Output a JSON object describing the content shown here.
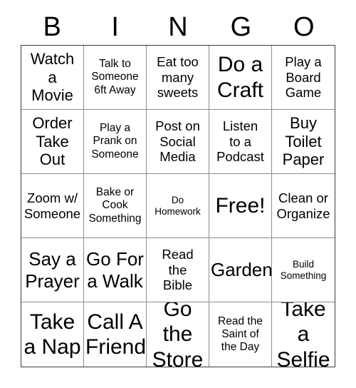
{
  "header": {
    "letters": [
      "B",
      "I",
      "N",
      "G",
      "O"
    ]
  },
  "grid": {
    "columns": 5,
    "rows": 5,
    "free_space_label": "Free!",
    "free_space_index": 12,
    "cells": [
      {
        "text": "Watch\na\nMovie",
        "size": "lg"
      },
      {
        "text": "Talk to\nSomeone\n6ft Away",
        "size": "sm"
      },
      {
        "text": "Eat too\nmany\nsweets",
        "size": "md"
      },
      {
        "text": "Do a\nCraft",
        "size": "xxl"
      },
      {
        "text": "Play a\nBoard\nGame",
        "size": "md"
      },
      {
        "text": "Order\nTake\nOut",
        "size": "lg"
      },
      {
        "text": "Play a\nPrank on\nSomeone",
        "size": "sm"
      },
      {
        "text": "Post on\nSocial\nMedia",
        "size": "md"
      },
      {
        "text": "Listen\nto a\nPodcast",
        "size": "md"
      },
      {
        "text": "Buy\nToilet\nPaper",
        "size": "lg"
      },
      {
        "text": "Zoom w/\nSomeone",
        "size": "md"
      },
      {
        "text": "Bake or\nCook\nSomething",
        "size": "sm"
      },
      {
        "text": "Do\nHomework",
        "size": "xs"
      },
      {
        "text": "Free!",
        "size": "xxl"
      },
      {
        "text": "Clean or\nOrganize",
        "size": "md"
      },
      {
        "text": "Say a\nPrayer",
        "size": "xl"
      },
      {
        "text": "Go For\na Walk",
        "size": "xl"
      },
      {
        "text": "Read\nthe\nBible",
        "size": "md"
      },
      {
        "text": "Garden",
        "size": "xl"
      },
      {
        "text": "Build\nSomething",
        "size": "xs"
      },
      {
        "text": "Take\na Nap",
        "size": "xxl"
      },
      {
        "text": "Call A\nFriend",
        "size": "xxl"
      },
      {
        "text": "Go the\nStore",
        "size": "xxl"
      },
      {
        "text": "Read the\nSaint of\nthe Day",
        "size": "sm"
      },
      {
        "text": "Take a\nSelfie",
        "size": "xxl"
      }
    ]
  },
  "colors": {
    "background": "#ffffff",
    "text": "#000000",
    "outer_border": "#3b3b3b",
    "inner_border": "#8c8c8c"
  }
}
